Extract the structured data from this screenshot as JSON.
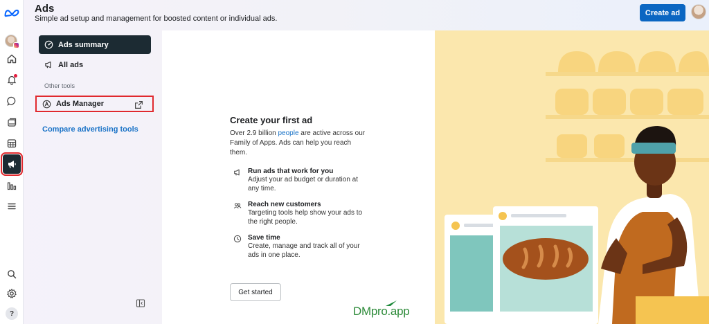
{
  "header": {
    "title": "Ads",
    "subtitle": "Simple ad setup and management for boosted content or individual ads.",
    "create_button": "Create ad"
  },
  "rail": {
    "icons": [
      "meta-logo-icon",
      "profile-avatar",
      "home-icon",
      "notifications-icon",
      "messages-icon",
      "content-icon",
      "planner-icon",
      "ads-icon",
      "insights-icon",
      "menu-icon",
      "search-icon",
      "settings-icon",
      "help-icon"
    ],
    "active": "ads-icon",
    "help_label": "?"
  },
  "menu": {
    "items": [
      {
        "label": "Ads summary",
        "icon": "gauge-icon",
        "selected": true
      },
      {
        "label": "All ads",
        "icon": "megaphone-icon",
        "selected": false
      }
    ],
    "section_label": "Other tools",
    "ads_manager": {
      "label": "Ads Manager",
      "icon": "ads-manager-logo-icon",
      "external": true
    },
    "compare_link": "Compare advertising tools"
  },
  "promo": {
    "title": "Create your first ad",
    "body_before": "Over 2.9 billion ",
    "body_link": "people",
    "body_after": " are active across our Family of Apps. Ads can help you reach them.",
    "benefits": [
      {
        "icon": "megaphone-icon",
        "title": "Run ads that work for you",
        "desc": "Adjust your ad budget or duration at any time."
      },
      {
        "icon": "people-icon",
        "title": "Reach new customers",
        "desc": "Targeting tools help show your ads to the right people."
      },
      {
        "icon": "clock-icon",
        "title": "Save time",
        "desc": "Create, manage and track all of your ads in one place."
      }
    ],
    "cta": "Get started"
  },
  "watermark": "DMpro.app",
  "colors": {
    "accent": "#0a66c2",
    "selected_bg": "#1c2b33",
    "highlight": "#e0292e",
    "link": "#1a73c7"
  }
}
